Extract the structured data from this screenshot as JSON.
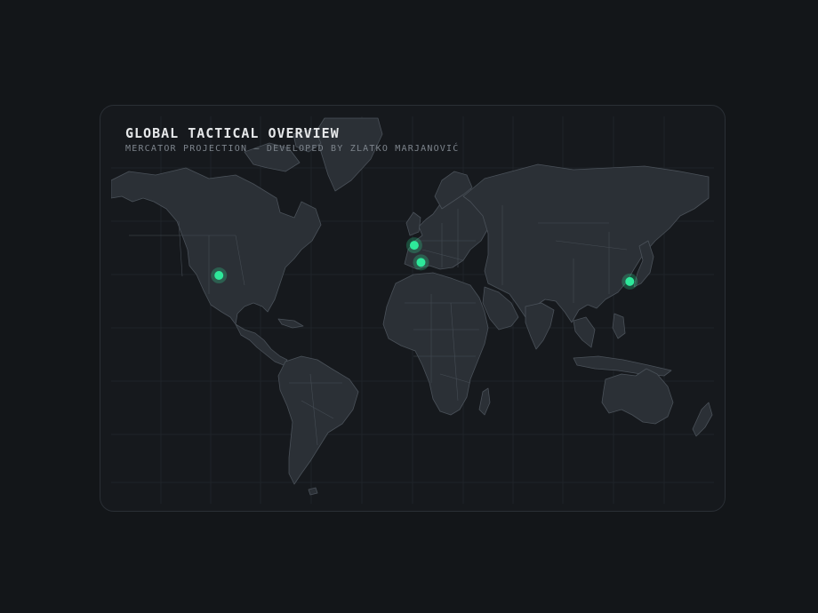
{
  "header": {
    "title": "GLOBAL TACTICAL OVERVIEW",
    "subtitle": "MERCATOR PROJECTION — DEVELOPED BY ZLATKO MARJANOVIĆ"
  },
  "map": {
    "projection": "mercator",
    "land_color": "#2b3036",
    "border_color": "#4a5159",
    "background_color": "#16191d",
    "marker_color": "#2ee89a",
    "markers": [
      {
        "name": "marker-usa",
        "lon": -104,
        "lat": 39
      },
      {
        "name": "marker-germany",
        "lon": 12,
        "lat": 52
      },
      {
        "name": "marker-italy",
        "lon": 16,
        "lat": 45
      },
      {
        "name": "marker-japan",
        "lon": 140,
        "lat": 36
      }
    ]
  }
}
